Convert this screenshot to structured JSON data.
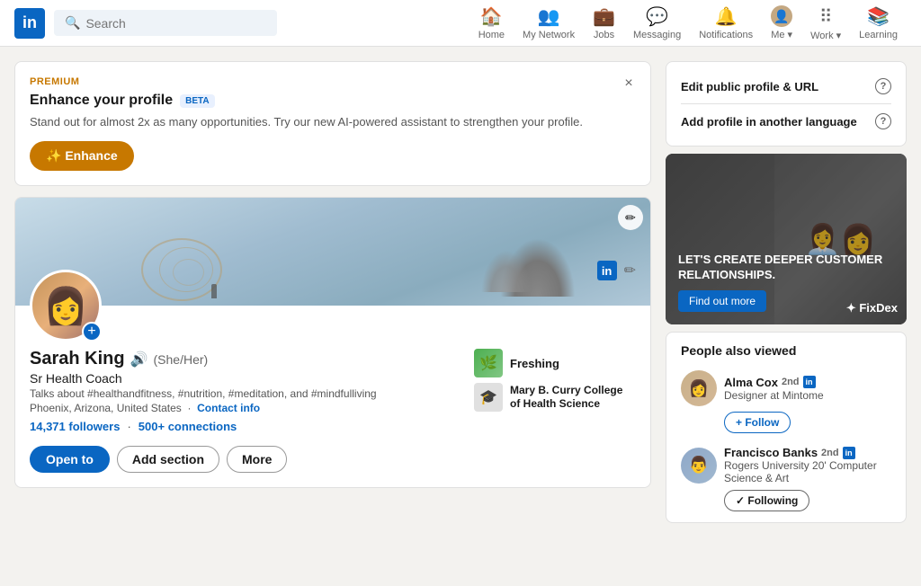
{
  "nav": {
    "logo_text": "in",
    "search_placeholder": "Search",
    "items": [
      {
        "id": "home",
        "label": "Home",
        "icon": "home"
      },
      {
        "id": "my-network",
        "label": "My Network",
        "icon": "network"
      },
      {
        "id": "jobs",
        "label": "Jobs",
        "icon": "jobs"
      },
      {
        "id": "messaging",
        "label": "Messaging",
        "icon": "messaging"
      },
      {
        "id": "notifications",
        "label": "Notifications",
        "icon": "bell"
      },
      {
        "id": "me",
        "label": "Me ▾",
        "icon": "avatar"
      },
      {
        "id": "work",
        "label": "Work ▾",
        "icon": "grid"
      },
      {
        "id": "learning",
        "label": "Learning",
        "icon": "learning"
      }
    ]
  },
  "premium_card": {
    "label": "PREMIUM",
    "title": "Enhance your profile",
    "beta": "BETA",
    "description": "Stand out for almost 2x as many opportunities. Try our new AI-powered assistant to strengthen your profile.",
    "enhance_btn": "✨ Enhance",
    "close": "×"
  },
  "profile": {
    "name": "Sarah King",
    "pronouns": "(She/Her)",
    "title": "Sr Health Coach",
    "description": "Talks about #healthandfitness, #nutrition, #meditation, and #mindfulliving",
    "location": "Phoenix, Arizona, United States",
    "contact_link": "Contact info",
    "followers": "14,371 followers",
    "connections": "500+ connections",
    "company_name": "Freshing",
    "school_name": "Mary B. Curry College of Health Science",
    "btn_open": "Open to",
    "btn_add_section": "Add section",
    "btn_more": "More",
    "edit_banner_icon": "✏",
    "plus_icon": "+",
    "sound_icon": "🔊"
  },
  "right_panel": {
    "edit_url_label": "Edit public  profile & URL",
    "add_language_label": "Add profile in another language",
    "ad": {
      "headline": "LET'S CREATE DEEPER CUSTOMER RELATIONSHIPS.",
      "cta": "Find out more",
      "brand": "FixDex"
    },
    "people_title": "People also viewed",
    "people": [
      {
        "name": "Alma Cox",
        "degree": "2nd",
        "role": "Designer at Mintome",
        "follow_label": "+ Follow",
        "follow_state": "follow"
      },
      {
        "name": "Francisco Banks",
        "degree": "2nd",
        "role": "Rogers University 20' Computer Science & Art",
        "follow_label": "✓ Following",
        "follow_state": "following"
      }
    ]
  }
}
